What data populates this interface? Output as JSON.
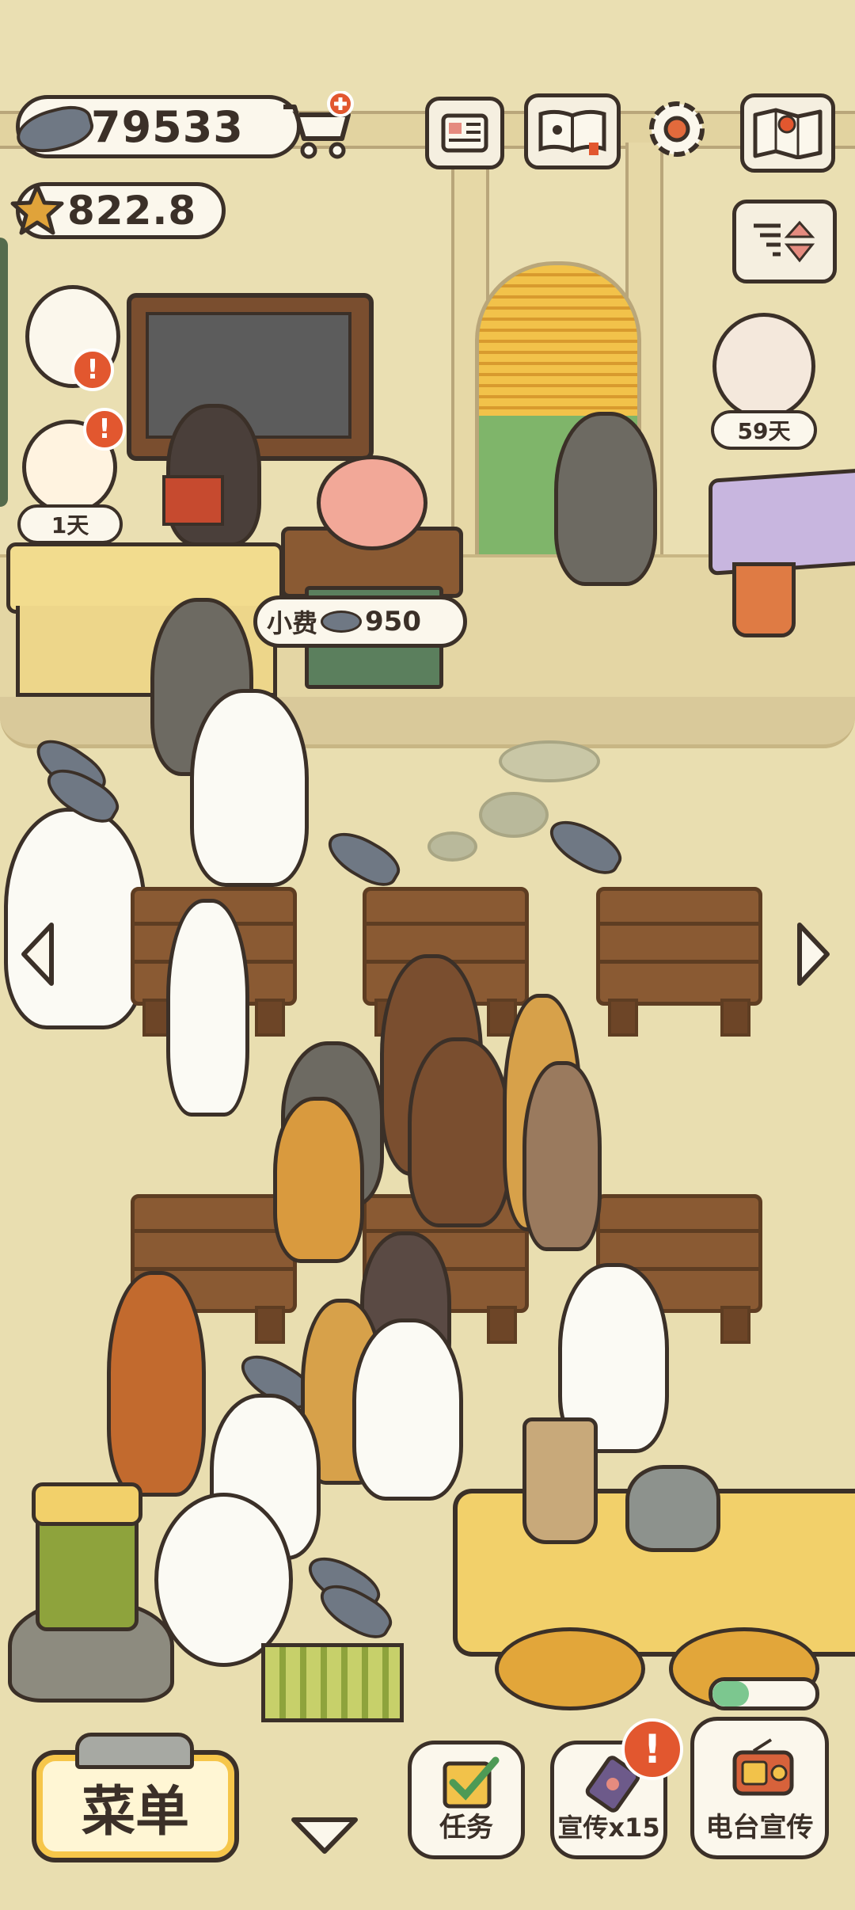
{
  "hud": {
    "fish_currency": "79533",
    "star_currency": "822.8"
  },
  "top_icons": [
    "news-icon",
    "recipe-book-icon",
    "gear-icon",
    "map-icon"
  ],
  "sort_button_icon": "sort-arrows-icon",
  "characters": {
    "left_guest_1_days": "1天",
    "right_guest_days": "59天"
  },
  "tip": {
    "label": "小费",
    "amount": "950"
  },
  "alerts": {
    "mark": "!"
  },
  "bottom_bar": {
    "menu_label": "菜单",
    "tasks_label": "任务",
    "promote_label": "宣传x15",
    "radio_label": "电台宣传"
  },
  "progress": {
    "radio_progress": 0.35
  },
  "colors": {
    "background": "#e7dcae",
    "text_dark": "#3b3028",
    "alert_red": "#e2572f",
    "menu_gold": "#f6c64a",
    "progress_green": "#7cc78f"
  }
}
